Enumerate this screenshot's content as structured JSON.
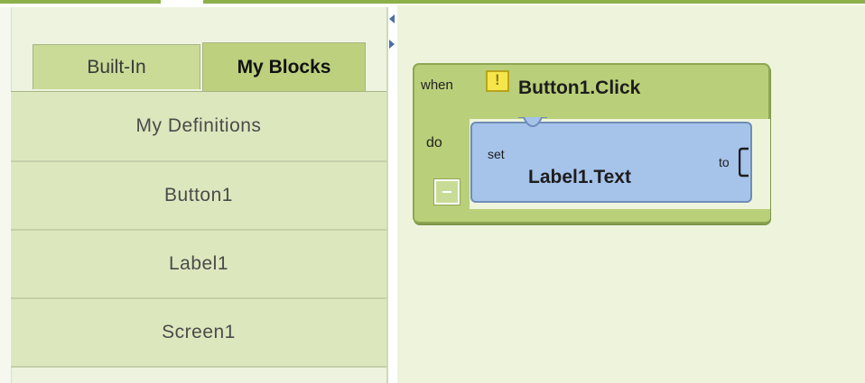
{
  "palette": {
    "tabs": [
      {
        "label": "Built-In",
        "active": false
      },
      {
        "label": "My Blocks",
        "active": true
      }
    ],
    "drawers": [
      {
        "label": "My Definitions"
      },
      {
        "label": "Button1"
      },
      {
        "label": "Label1"
      },
      {
        "label": "Screen1"
      }
    ]
  },
  "workspace": {
    "event_block": {
      "when_label": "when",
      "event_name": "Button1.Click",
      "do_label": "do",
      "warning_icon": "warning-icon",
      "collapse_icon": "collapse-icon"
    },
    "setter_block": {
      "set_label": "set",
      "property": "Label1.Text",
      "to_label": "to"
    }
  },
  "colors": {
    "accent_green": "#8db04a",
    "event_block": "#b9cf79",
    "setter_block": "#a6c3ea",
    "workspace": "#eef4dc",
    "warning": "#f6e64c"
  }
}
